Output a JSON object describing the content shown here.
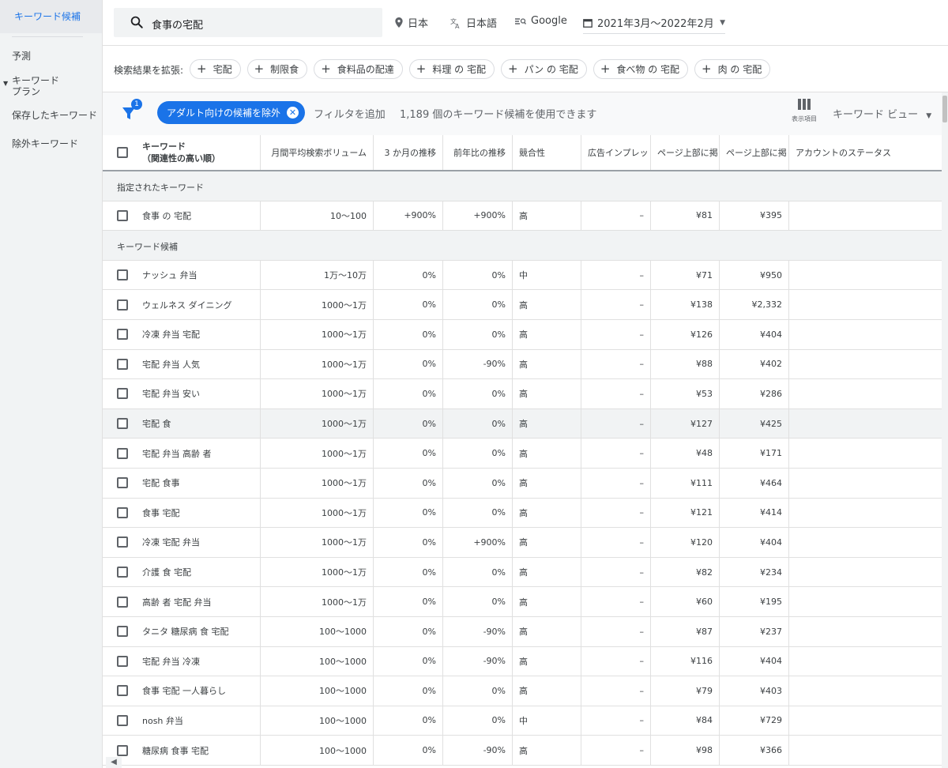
{
  "sidebar": {
    "items": [
      {
        "label": "キーワード候補"
      },
      {
        "label": "予測"
      },
      {
        "label": "キーワード\nプラン"
      },
      {
        "label": "保存したキーワード"
      },
      {
        "label": "除外キーワード"
      }
    ]
  },
  "topbar": {
    "search_value": "食事の宅配",
    "location": "日本",
    "language": "日本語",
    "network": "Google",
    "date_range": "2021年3月～2022年2月"
  },
  "expand": {
    "label": "検索結果を拡張:",
    "chips": [
      "宅配",
      "制限食",
      "食料品の配達",
      "料理 の 宅配",
      "パン の 宅配",
      "食べ物 の 宅配",
      "肉 の 宅配"
    ]
  },
  "filterbar": {
    "filter_count": "1",
    "adult_chip": "アダルト向けの候補を除外",
    "add_filter": "フィルタを追加",
    "count_text": "1,189 個のキーワード候補を使用できます",
    "columns_label": "表示項目",
    "view_label": "キーワード ビュー"
  },
  "table": {
    "headers": {
      "keyword": "キーワード",
      "keyword_sub": "（関連性の高い順）",
      "volume": "月間平均検索ボリューム",
      "three_month": "3 か月の推移",
      "yoy": "前年比の推移",
      "competition": "競合性",
      "impression": "広告インプレッ",
      "low_bid": "ページ上部に掲",
      "high_bid": "ページ上部に掲",
      "account": "アカウントのステータス"
    },
    "section_specified": "指定されたキーワード",
    "specified_rows": [
      {
        "kw": "食事 の 宅配",
        "vol": "10～100",
        "m3": "+900%",
        "yoy": "+900%",
        "comp": "高",
        "imp": "–",
        "low": "¥81",
        "high": "¥395"
      }
    ],
    "section_ideas": "キーワード候補",
    "idea_rows": [
      {
        "kw": "ナッシュ 弁当",
        "vol": "1万～10万",
        "m3": "0%",
        "yoy": "0%",
        "comp": "中",
        "imp": "–",
        "low": "¥71",
        "high": "¥950"
      },
      {
        "kw": "ウェルネス ダイニング",
        "vol": "1000～1万",
        "m3": "0%",
        "yoy": "0%",
        "comp": "高",
        "imp": "–",
        "low": "¥138",
        "high": "¥2,332"
      },
      {
        "kw": "冷凍 弁当 宅配",
        "vol": "1000～1万",
        "m3": "0%",
        "yoy": "0%",
        "comp": "高",
        "imp": "–",
        "low": "¥126",
        "high": "¥404"
      },
      {
        "kw": "宅配 弁当 人気",
        "vol": "1000～1万",
        "m3": "0%",
        "yoy": "-90%",
        "comp": "高",
        "imp": "–",
        "low": "¥88",
        "high": "¥402"
      },
      {
        "kw": "宅配 弁当 安い",
        "vol": "1000～1万",
        "m3": "0%",
        "yoy": "0%",
        "comp": "高",
        "imp": "–",
        "low": "¥53",
        "high": "¥286"
      },
      {
        "kw": "宅配 食",
        "vol": "1000～1万",
        "m3": "0%",
        "yoy": "0%",
        "comp": "高",
        "imp": "–",
        "low": "¥127",
        "high": "¥425"
      },
      {
        "kw": "宅配 弁当 高齢 者",
        "vol": "1000～1万",
        "m3": "0%",
        "yoy": "0%",
        "comp": "高",
        "imp": "–",
        "low": "¥48",
        "high": "¥171"
      },
      {
        "kw": "宅配 食事",
        "vol": "1000～1万",
        "m3": "0%",
        "yoy": "0%",
        "comp": "高",
        "imp": "–",
        "low": "¥111",
        "high": "¥464"
      },
      {
        "kw": "食事 宅配",
        "vol": "1000～1万",
        "m3": "0%",
        "yoy": "0%",
        "comp": "高",
        "imp": "–",
        "low": "¥121",
        "high": "¥414"
      },
      {
        "kw": "冷凍 宅配 弁当",
        "vol": "1000～1万",
        "m3": "0%",
        "yoy": "+900%",
        "comp": "高",
        "imp": "–",
        "low": "¥120",
        "high": "¥404"
      },
      {
        "kw": "介護 食 宅配",
        "vol": "1000～1万",
        "m3": "0%",
        "yoy": "0%",
        "comp": "高",
        "imp": "–",
        "low": "¥82",
        "high": "¥234"
      },
      {
        "kw": "高齢 者 宅配 弁当",
        "vol": "1000～1万",
        "m3": "0%",
        "yoy": "0%",
        "comp": "高",
        "imp": "–",
        "low": "¥60",
        "high": "¥195"
      },
      {
        "kw": "タニタ 糖尿病 食 宅配",
        "vol": "100～1000",
        "m3": "0%",
        "yoy": "-90%",
        "comp": "高",
        "imp": "–",
        "low": "¥87",
        "high": "¥237"
      },
      {
        "kw": "宅配 弁当 冷凍",
        "vol": "100～1000",
        "m3": "0%",
        "yoy": "-90%",
        "comp": "高",
        "imp": "–",
        "low": "¥116",
        "high": "¥404"
      },
      {
        "kw": "食事 宅配 一人暮らし",
        "vol": "100～1000",
        "m3": "0%",
        "yoy": "0%",
        "comp": "高",
        "imp": "–",
        "low": "¥79",
        "high": "¥403"
      },
      {
        "kw": "nosh 弁当",
        "vol": "100～1000",
        "m3": "0%",
        "yoy": "0%",
        "comp": "中",
        "imp": "–",
        "low": "¥84",
        "high": "¥729"
      },
      {
        "kw": "糖尿病 食事 宅配",
        "vol": "100～1000",
        "m3": "0%",
        "yoy": "-90%",
        "comp": "高",
        "imp": "–",
        "low": "¥98",
        "high": "¥366"
      }
    ]
  },
  "colors": {
    "accent": "#1a73e8",
    "sidebar_bg": "#f1f3f4",
    "section_bg": "#f1f3f4"
  }
}
